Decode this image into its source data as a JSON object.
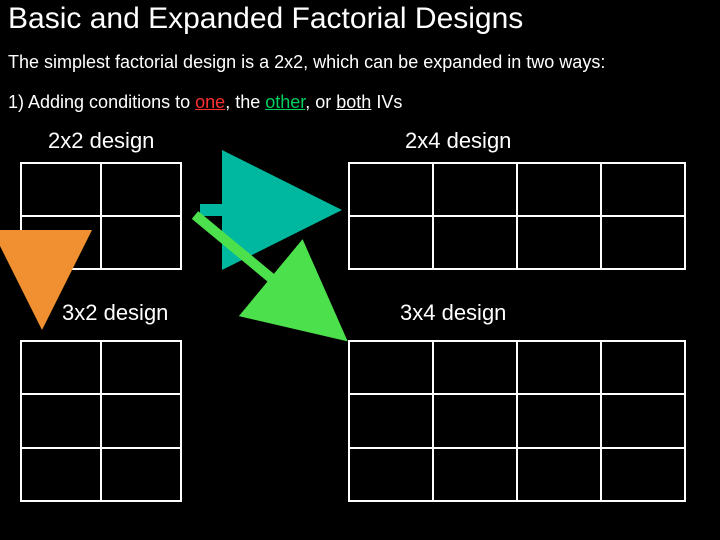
{
  "title": "Basic and Expanded Factorial Designs",
  "subtitle": "The simplest factorial design is a 2x2, which can be expanded in two ways:",
  "line1_prefix": "1) Adding conditions to ",
  "one": "one",
  "sep1": ", the ",
  "other": "other",
  "sep2": ", or ",
  "both": "both",
  "line1_suffix": " IVs",
  "labels": {
    "d2x2": "2x2 design",
    "d2x4": "2x4 design",
    "d3x2": "3x2 design",
    "d3x4": "3x4 design"
  },
  "grids": {
    "d2x2": {
      "rows": 2,
      "cols": 2
    },
    "d2x4": {
      "rows": 2,
      "cols": 4
    },
    "d3x2": {
      "rows": 3,
      "cols": 2
    },
    "d3x4": {
      "rows": 3,
      "cols": 4
    }
  },
  "colors": {
    "teal": "#00B89F",
    "orange": "#F09030",
    "green": "#4CE04C"
  }
}
